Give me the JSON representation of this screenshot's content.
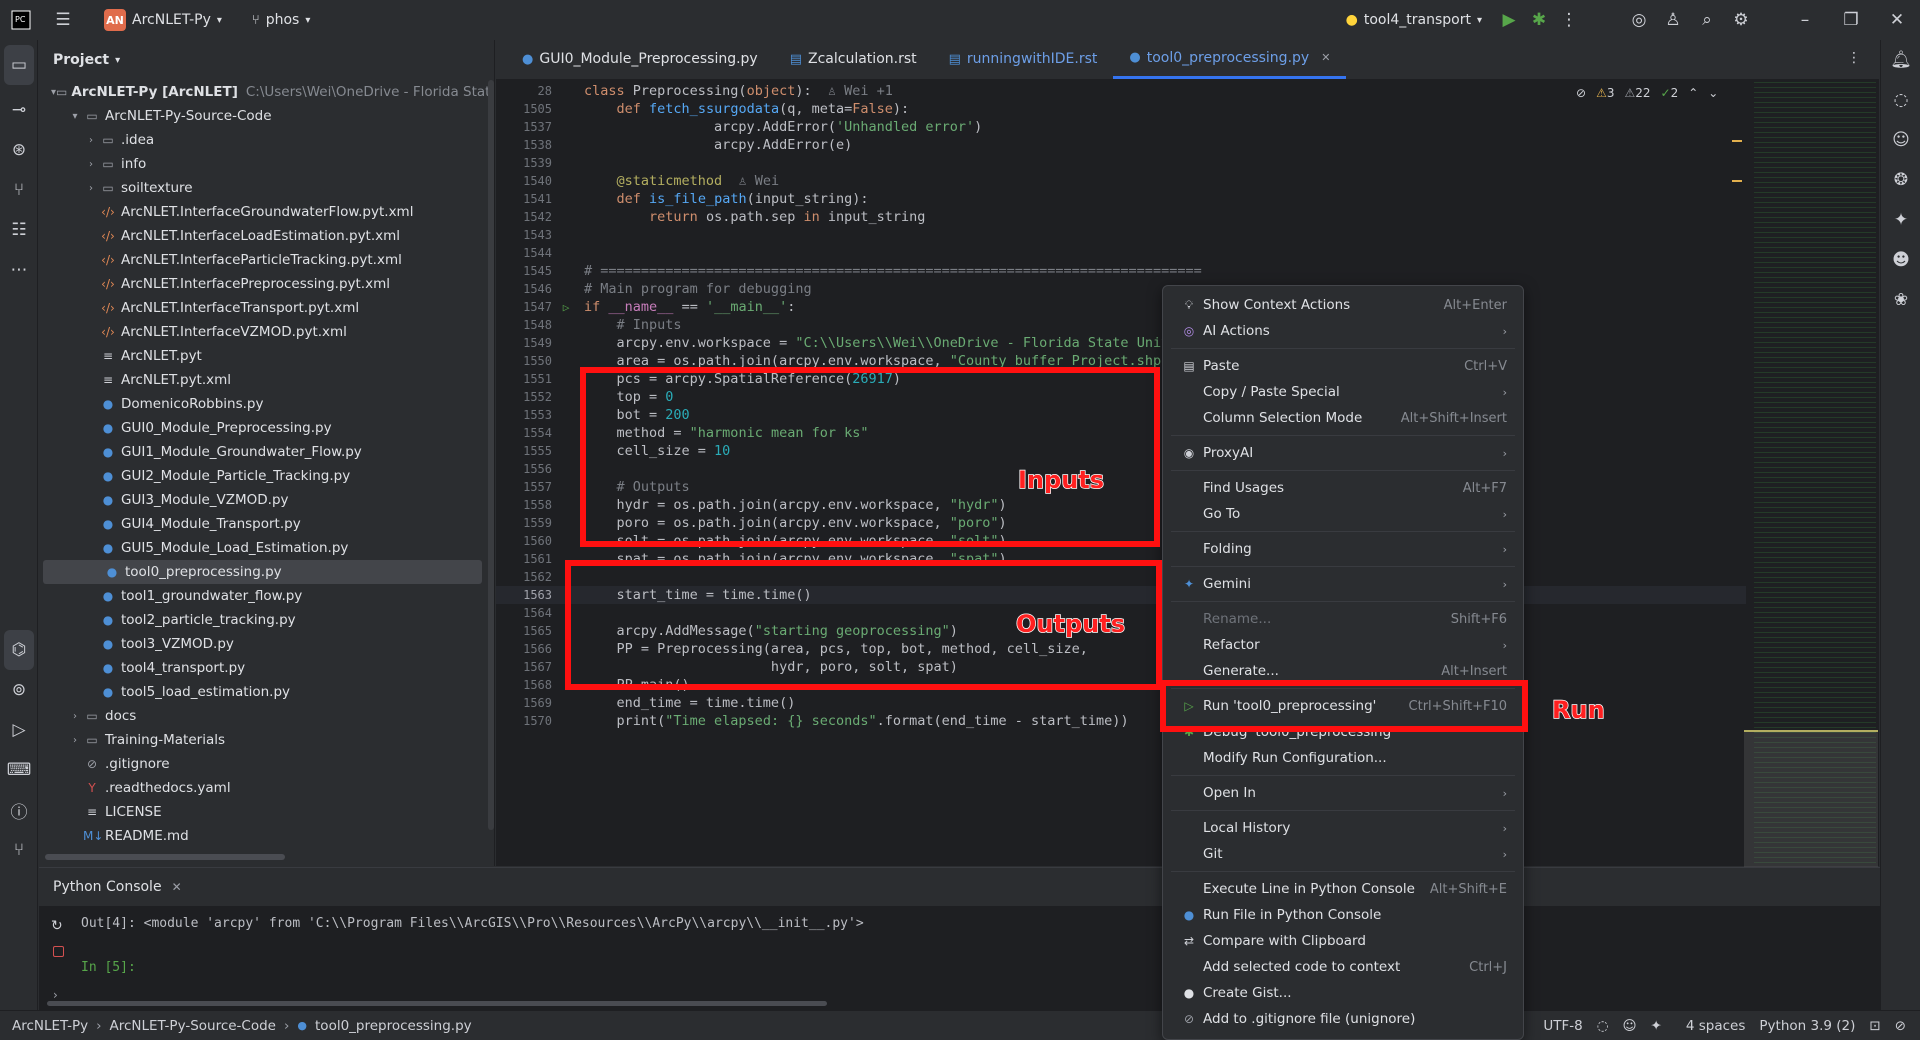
{
  "titlebar": {
    "project_badge": "AN",
    "project_name": "ArcNLET-Py",
    "branch": "phos",
    "run_config": "tool4_transport"
  },
  "project_panel": {
    "title": "Project",
    "tree": [
      {
        "depth": 0,
        "arrow": "▾",
        "icon": "folder-icon",
        "label": "ArcNLET-Py [ArcNLET]",
        "hint": "C:\\Users\\Wei\\OneDrive - Florida State U"
      },
      {
        "depth": 1,
        "arrow": "▾",
        "icon": "folder-icon",
        "label": "ArcNLET-Py-Source-Code",
        "hint": ""
      },
      {
        "depth": 2,
        "arrow": "›",
        "icon": "folder-icon",
        "label": ".idea",
        "hint": ""
      },
      {
        "depth": 2,
        "arrow": "›",
        "icon": "folder-icon",
        "label": "info",
        "hint": ""
      },
      {
        "depth": 2,
        "arrow": "›",
        "icon": "folder-icon",
        "label": "soiltexture",
        "hint": ""
      },
      {
        "depth": 2,
        "arrow": "",
        "icon": "xml-icon",
        "label": "ArcNLET.InterfaceGroundwaterFlow.pyt.xml",
        "hint": ""
      },
      {
        "depth": 2,
        "arrow": "",
        "icon": "xml-icon",
        "label": "ArcNLET.InterfaceLoadEstimation.pyt.xml",
        "hint": ""
      },
      {
        "depth": 2,
        "arrow": "",
        "icon": "xml-icon",
        "label": "ArcNLET.InterfaceParticleTracking.pyt.xml",
        "hint": ""
      },
      {
        "depth": 2,
        "arrow": "",
        "icon": "xml-icon",
        "label": "ArcNLET.InterfacePreprocessing.pyt.xml",
        "hint": ""
      },
      {
        "depth": 2,
        "arrow": "",
        "icon": "xml-icon",
        "label": "ArcNLET.InterfaceTransport.pyt.xml",
        "hint": ""
      },
      {
        "depth": 2,
        "arrow": "",
        "icon": "xml-icon",
        "label": "ArcNLET.InterfaceVZMOD.pyt.xml",
        "hint": ""
      },
      {
        "depth": 2,
        "arrow": "",
        "icon": "text-icon",
        "label": "ArcNLET.pyt",
        "hint": ""
      },
      {
        "depth": 2,
        "arrow": "",
        "icon": "text-icon",
        "label": "ArcNLET.pyt.xml",
        "hint": ""
      },
      {
        "depth": 2,
        "arrow": "",
        "icon": "python-icon",
        "label": "DomenicoRobbins.py",
        "hint": ""
      },
      {
        "depth": 2,
        "arrow": "",
        "icon": "python-icon",
        "label": "GUI0_Module_Preprocessing.py",
        "hint": ""
      },
      {
        "depth": 2,
        "arrow": "",
        "icon": "python-icon",
        "label": "GUI1_Module_Groundwater_Flow.py",
        "hint": ""
      },
      {
        "depth": 2,
        "arrow": "",
        "icon": "python-icon",
        "label": "GUI2_Module_Particle_Tracking.py",
        "hint": ""
      },
      {
        "depth": 2,
        "arrow": "",
        "icon": "python-icon",
        "label": "GUI3_Module_VZMOD.py",
        "hint": ""
      },
      {
        "depth": 2,
        "arrow": "",
        "icon": "python-icon",
        "label": "GUI4_Module_Transport.py",
        "hint": ""
      },
      {
        "depth": 2,
        "arrow": "",
        "icon": "python-icon",
        "label": "GUI5_Module_Load_Estimation.py",
        "hint": ""
      },
      {
        "depth": 2,
        "arrow": "",
        "icon": "python-icon",
        "label": "tool0_preprocessing.py",
        "hint": "",
        "selected": true
      },
      {
        "depth": 2,
        "arrow": "",
        "icon": "python-icon",
        "label": "tool1_groundwater_flow.py",
        "hint": ""
      },
      {
        "depth": 2,
        "arrow": "",
        "icon": "python-icon",
        "label": "tool2_particle_tracking.py",
        "hint": ""
      },
      {
        "depth": 2,
        "arrow": "",
        "icon": "python-icon",
        "label": "tool3_VZMOD.py",
        "hint": ""
      },
      {
        "depth": 2,
        "arrow": "",
        "icon": "python-icon",
        "label": "tool4_transport.py",
        "hint": ""
      },
      {
        "depth": 2,
        "arrow": "",
        "icon": "python-icon",
        "label": "tool5_load_estimation.py",
        "hint": ""
      },
      {
        "depth": 1,
        "arrow": "›",
        "icon": "folder-icon",
        "label": "docs",
        "hint": ""
      },
      {
        "depth": 1,
        "arrow": "›",
        "icon": "folder-icon",
        "label": "Training-Materials",
        "hint": ""
      },
      {
        "depth": 1,
        "arrow": "",
        "icon": "gitignore-icon",
        "label": ".gitignore",
        "hint": ""
      },
      {
        "depth": 1,
        "arrow": "",
        "icon": "yaml-icon",
        "label": ".readthedocs.yaml",
        "hint": ""
      },
      {
        "depth": 1,
        "arrow": "",
        "icon": "text-icon",
        "label": "LICENSE",
        "hint": ""
      },
      {
        "depth": 1,
        "arrow": "",
        "icon": "markdown-icon",
        "label": "README.md",
        "hint": ""
      }
    ]
  },
  "tabs": [
    {
      "label": "GUI0_Module_Preprocessing.py",
      "icon": "python-icon",
      "active": false
    },
    {
      "label": "Zcalculation.rst",
      "icon": "rst-icon",
      "active": false
    },
    {
      "label": "runningwithIDE.rst",
      "icon": "rst-icon",
      "active": false
    },
    {
      "label": "tool0_preprocessing.py",
      "icon": "python-icon",
      "active": true
    }
  ],
  "inspections": {
    "warnings": "3",
    "weak": "22",
    "ok": "2"
  },
  "code_lines": [
    {
      "n": "28",
      "html": "<span class='kw'>class</span> Preprocessing(<span class='kw'>object</span>):  <span class='cmt'>♙ Wei +1</span>"
    },
    {
      "n": "1505",
      "html": "    <span class='kw'>def</span> <span class='fn'>fetch_ssurgodata</span>(q, meta=<span class='kw'>False</span>):"
    },
    {
      "n": "1537",
      "html": "                arcpy.AddError(<span class='str'>'Unhandled error'</span>)"
    },
    {
      "n": "1538",
      "html": "                arcpy.AddError(e)"
    },
    {
      "n": "1539",
      "html": ""
    },
    {
      "n": "1540",
      "html": "    <span class='dec'>@staticmethod</span>  <span class='cmt'>♙ Wei</span>"
    },
    {
      "n": "1541",
      "html": "    <span class='kw'>def</span> <span class='fn'>is_file_path</span>(input_string):"
    },
    {
      "n": "1542",
      "html": "        <span class='kw'>return</span> os.path.sep <span class='kw'>in</span> input_string"
    },
    {
      "n": "1543",
      "html": ""
    },
    {
      "n": "1544",
      "html": ""
    },
    {
      "n": "1545",
      "html": "<span class='cmt'># ==========================================================================</span>"
    },
    {
      "n": "1546",
      "html": "<span class='cmt'># Main program for debugging</span>"
    },
    {
      "n": "1547",
      "html": "<span class='kw'>if</span> <span class='par'>__name__</span> == <span class='str'>'__main__'</span>:",
      "run": true
    },
    {
      "n": "1548",
      "html": "    <span class='cmt'># Inputs</span>"
    },
    {
      "n": "1549",
      "html": "    arcpy.env.workspace = <span class='str'>\"C:\\\\Users\\\\Wei\\\\OneDrive - Florida State Unive</span>"
    },
    {
      "n": "1550",
      "html": "    area = os.path.join(arcpy.env.workspace, <span class='str'>\"County_buffer_Project.shp\"</span>)"
    },
    {
      "n": "1551",
      "html": "    pcs = arcpy.SpatialReference(<span class='num'>26917</span>)"
    },
    {
      "n": "1552",
      "html": "    top = <span class='num'>0</span>"
    },
    {
      "n": "1553",
      "html": "    bot = <span class='num'>200</span>"
    },
    {
      "n": "1554",
      "html": "    method = <span class='str'>\"harmonic mean for ks\"</span>"
    },
    {
      "n": "1555",
      "html": "    cell_size = <span class='num'>10</span>"
    },
    {
      "n": "1556",
      "html": ""
    },
    {
      "n": "1557",
      "html": "    <span class='cmt'># Outputs</span>"
    },
    {
      "n": "1558",
      "html": "    hydr = os.path.join(arcpy.env.workspace, <span class='str'>\"hydr\"</span>)"
    },
    {
      "n": "1559",
      "html": "    poro = os.path.join(arcpy.env.workspace, <span class='str'>\"poro\"</span>)"
    },
    {
      "n": "1560",
      "html": "    solt = os.path.join(arcpy.env.workspace, <span class='str'>\"solt\"</span>)"
    },
    {
      "n": "1561",
      "html": "    spat = os.path.join(arcpy.env.workspace, <span class='str'>\"spat\"</span>)"
    },
    {
      "n": "1562",
      "html": ""
    },
    {
      "n": "1563",
      "html": "    start_time = time.time()",
      "current": true
    },
    {
      "n": "1564",
      "html": ""
    },
    {
      "n": "1565",
      "html": "    arcpy.AddMessage(<span class='str'>\"starting geoprocessing\"</span>)"
    },
    {
      "n": "1566",
      "html": "    PP = Preprocessing(area, pcs, top, bot, method, cell_size,"
    },
    {
      "n": "1567",
      "html": "                       hydr, poro, solt, spat)"
    },
    {
      "n": "1568",
      "html": "    PP.main()"
    },
    {
      "n": "1569",
      "html": "    end_time = time.time()"
    },
    {
      "n": "1570",
      "html": "    print(<span class='str'>\"Time elapsed: {} seconds\"</span>.format(end_time - start_time))"
    }
  ],
  "console": {
    "title": "Python Console",
    "output": "Out[4]: <module 'arcpy' from 'C:\\\\Program Files\\\\ArcGIS\\\\Pro\\\\Resources\\\\ArcPy\\\\arcpy\\\\__init__.py'>",
    "prompt": "In [5]:"
  },
  "context_menu": [
    {
      "icon": "bulb-icon",
      "label": "Show Context Actions",
      "shortcut": "Alt+Enter"
    },
    {
      "icon": "ai-icon",
      "label": "AI Actions",
      "shortcut": "",
      "sub": true
    },
    {
      "sep": true
    },
    {
      "icon": "clipboard-icon",
      "label": "Paste",
      "shortcut": "Ctrl+V"
    },
    {
      "icon": "",
      "label": "Copy / Paste Special",
      "shortcut": "",
      "sub": true
    },
    {
      "icon": "",
      "label": "Column Selection Mode",
      "shortcut": "Alt+Shift+Insert"
    },
    {
      "sep": true
    },
    {
      "icon": "proxy-icon",
      "label": "ProxyAI",
      "shortcut": "",
      "sub": true
    },
    {
      "sep": true
    },
    {
      "icon": "",
      "label": "Find Usages",
      "shortcut": "Alt+F7"
    },
    {
      "icon": "",
      "label": "Go To",
      "shortcut": "",
      "sub": true
    },
    {
      "sep": true
    },
    {
      "icon": "",
      "label": "Folding",
      "shortcut": "",
      "sub": true
    },
    {
      "sep": true
    },
    {
      "icon": "gemini-icon",
      "label": "Gemini",
      "shortcut": "",
      "sub": true
    },
    {
      "sep": true
    },
    {
      "icon": "",
      "label": "Rename...",
      "shortcut": "Shift+F6",
      "disabled": true
    },
    {
      "icon": "",
      "label": "Refactor",
      "shortcut": "",
      "sub": true
    },
    {
      "icon": "",
      "label": "Generate...",
      "shortcut": "Alt+Insert"
    },
    {
      "sep": true
    },
    {
      "icon": "run-icon",
      "label": "Run 'tool0_preprocessing'",
      "shortcut": "Ctrl+Shift+F10"
    },
    {
      "icon": "debug-icon",
      "label": "Debug 'tool0_preprocessing'",
      "shortcut": ""
    },
    {
      "icon": "",
      "label": "Modify Run Configuration...",
      "shortcut": ""
    },
    {
      "sep": true
    },
    {
      "icon": "",
      "label": "Open In",
      "shortcut": "",
      "sub": true
    },
    {
      "sep": true
    },
    {
      "icon": "",
      "label": "Local History",
      "shortcut": "",
      "sub": true
    },
    {
      "icon": "",
      "label": "Git",
      "shortcut": "",
      "sub": true
    },
    {
      "sep": true
    },
    {
      "icon": "",
      "label": "Execute Line in Python Console",
      "shortcut": "Alt+Shift+E"
    },
    {
      "icon": "python-icon",
      "label": "Run File in Python Console",
      "shortcut": ""
    },
    {
      "icon": "compare-icon",
      "label": "Compare with Clipboard",
      "shortcut": ""
    },
    {
      "icon": "",
      "label": "Add selected code to context",
      "shortcut": "Ctrl+J"
    },
    {
      "icon": "github-icon",
      "label": "Create Gist...",
      "shortcut": ""
    },
    {
      "icon": "gitignore-icon",
      "label": "Add to .gitignore file (unignore)",
      "shortcut": ""
    }
  ],
  "annotations": {
    "inputs": "Inputs",
    "outputs": "Outputs",
    "run": "Run"
  },
  "statusbar": {
    "breadcrumb": [
      "ArcNLET-Py",
      "ArcNLET-Py-Source-Code",
      "tool0_preprocessing.py"
    ],
    "encoding": "UTF-8",
    "indent": "4 spaces",
    "interpreter": "Python 3.9 (2)"
  },
  "colors": {
    "accent": "#3574f0",
    "annotation_red": "#ff1010",
    "run_green": "#57a64a"
  }
}
